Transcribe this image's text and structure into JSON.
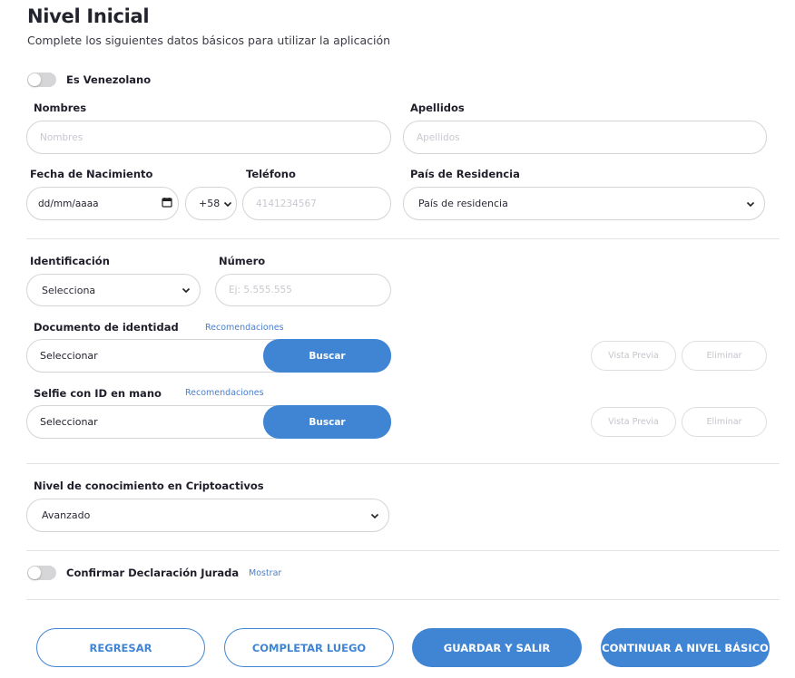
{
  "header": {
    "title": "Nivel Inicial",
    "subtitle": "Complete los siguientes datos básicos para utilizar la aplicación"
  },
  "venezolano_toggle": {
    "label": "Es Venezolano",
    "checked": false
  },
  "fields": {
    "nombres": {
      "label": "Nombres",
      "placeholder": "Nombres"
    },
    "apellidos": {
      "label": "Apellidos",
      "placeholder": "Apellidos"
    },
    "fecha_nacimiento": {
      "label": "Fecha de Nacimiento",
      "value": "dd/mm/aaaa"
    },
    "telefono": {
      "label": "Teléfono",
      "prefix": "+58",
      "placeholder": "4141234567"
    },
    "pais": {
      "label": "País de Residencia",
      "value": "País de residencia"
    },
    "identificacion": {
      "label": "Identificación",
      "value": "Selecciona"
    },
    "numero": {
      "label": "Número",
      "placeholder": "Ej: 5.555.555"
    },
    "documento": {
      "label": "Documento de identidad",
      "link": "Recomendaciones",
      "value": "Seleccionar",
      "search": "Buscar",
      "preview": "Vista Previa",
      "delete": "Eliminar"
    },
    "selfie": {
      "label": "Selfie con ID en mano",
      "link": "Recomendaciones",
      "value": "Seleccionar",
      "search": "Buscar",
      "preview": "Vista Previa",
      "delete": "Eliminar"
    },
    "cripto": {
      "label": "Nivel de conocimiento en Criptoactivos",
      "value": "Avanzado"
    }
  },
  "declaracion_toggle": {
    "label": "Confirmar Declaración Jurada",
    "link": "Mostrar",
    "checked": false
  },
  "footer": {
    "back": "REGRESAR",
    "later": "COMPLETAR LUEGO",
    "save": "GUARDAR Y SALIR",
    "continue": "CONTINUAR A NIVEL BÁSICO"
  },
  "colors": {
    "accent": "#3f85d4",
    "divider": "#e2e2e6",
    "placeholder": "#c8c8d0"
  }
}
